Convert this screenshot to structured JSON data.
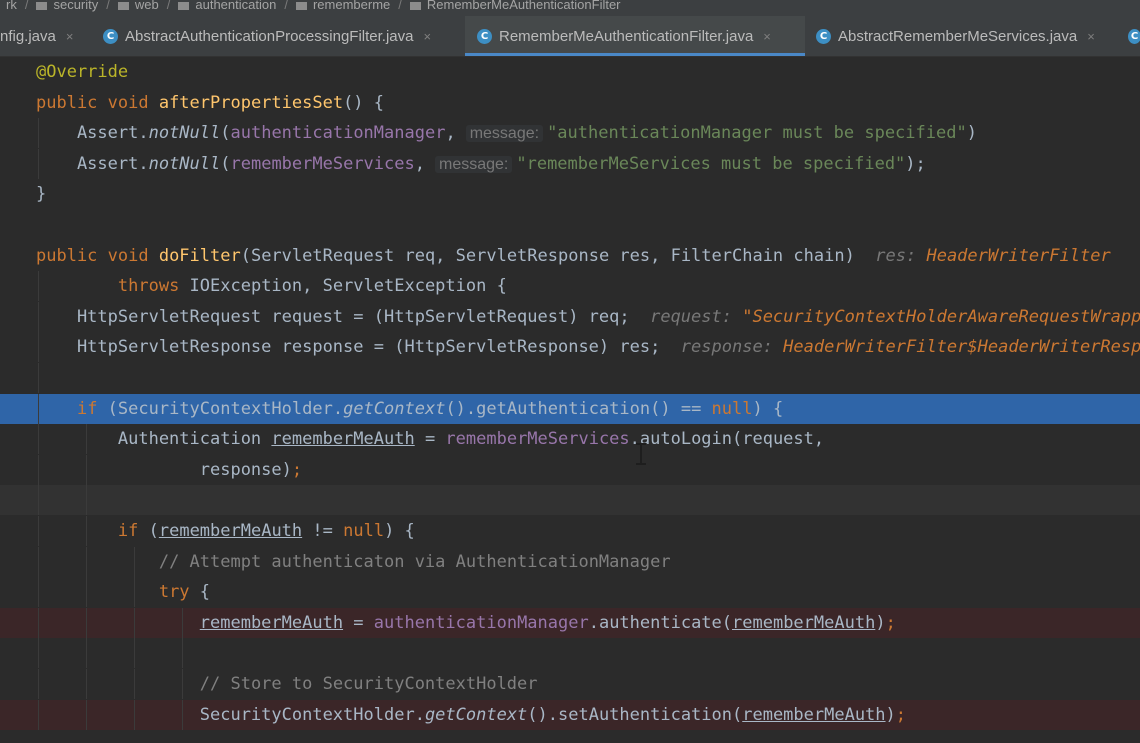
{
  "breadcrumb": [
    "rk",
    "security",
    "web",
    "authentication",
    "rememberme",
    "RememberMeAuthenticationFilter"
  ],
  "tabs": [
    {
      "label": "nfig.java",
      "close": "×"
    },
    {
      "label": "AbstractAuthenticationProcessingFilter.java",
      "close": "×"
    },
    {
      "label": "RememberMeAuthenticationFilter.java",
      "close": "×"
    },
    {
      "label": "AbstractRememberMeServices.java",
      "close": "×"
    }
  ],
  "icons": {
    "tab_class": "C",
    "tab_class_color": "#3d8fc4"
  },
  "colors": {
    "background": "#2b2b2b",
    "current_line": "#2f65a8",
    "breakpoint_line": "#3b2628",
    "keyword": "#cc7832",
    "string": "#6a8759",
    "field": "#9876aa",
    "function": "#ffc66d",
    "comment": "#808080"
  },
  "code": [
    [
      {
        "t": "@Override",
        "c": "ann"
      }
    ],
    [
      {
        "t": "public void ",
        "c": "kw"
      },
      {
        "t": "afterPropertiesSet",
        "c": "fn"
      },
      {
        "t": "() {"
      }
    ],
    [
      {
        "t": "    Assert."
      },
      {
        "t": "notNull",
        "c": "it"
      },
      {
        "t": "("
      },
      {
        "t": "authenticationManager",
        "c": "fld"
      },
      {
        "t": ","
      },
      {
        "t": "message:",
        "c": "hint"
      },
      {
        "t": "\"authenticationManager must be specified\"",
        "c": "str"
      },
      {
        "t": ")"
      }
    ],
    [
      {
        "t": "    Assert."
      },
      {
        "t": "notNull",
        "c": "it"
      },
      {
        "t": "("
      },
      {
        "t": "rememberMeServices",
        "c": "fld"
      },
      {
        "t": ","
      },
      {
        "t": "message:",
        "c": "hint"
      },
      {
        "t": "\"rememberMeServices must be specified\"",
        "c": "str"
      },
      {
        "t": ");"
      }
    ],
    [
      {
        "t": "}"
      }
    ],
    [],
    [
      {
        "t": "public void ",
        "c": "kw"
      },
      {
        "t": "doFilter",
        "c": "fn"
      },
      {
        "t": "(ServletRequest req, ServletResponse res, FilterChain chain)  "
      },
      {
        "t": "res: ",
        "c": "dbg"
      },
      {
        "t": "HeaderWriterFilter",
        "c": "dbgv"
      }
    ],
    [
      {
        "t": "        "
      },
      {
        "t": "throws ",
        "c": "kw"
      },
      {
        "t": "IOException, ServletException {"
      }
    ],
    [
      {
        "t": "    HttpServletRequest request = (HttpServletRequest) req;  "
      },
      {
        "t": "request: ",
        "c": "dbg"
      },
      {
        "t": "\"SecurityContextHolderAwareRequestWrapper\"",
        "c": "dbgv"
      }
    ],
    [
      {
        "t": "    HttpServletResponse response = (HttpServletResponse) res;  "
      },
      {
        "t": "response: ",
        "c": "dbg"
      },
      {
        "t": "HeaderWriterFilter$HeaderWriterResponse",
        "c": "dbgv"
      }
    ],
    [],
    [
      {
        "t": "    "
      },
      {
        "t": "if ",
        "c": "kw"
      },
      {
        "t": "(SecurityContextHolder."
      },
      {
        "t": "getContext",
        "c": "it"
      },
      {
        "t": "().getAuthentication() == "
      },
      {
        "t": "null",
        "c": "kw"
      },
      {
        "t": ") {"
      }
    ],
    [
      {
        "t": "        Authentication "
      },
      {
        "t": "rememberMeAuth",
        "c": "ul"
      },
      {
        "t": " = "
      },
      {
        "t": "rememberMeServices",
        "c": "fld"
      },
      {
        "t": ".autoLogin(request,"
      }
    ],
    [
      {
        "t": "                response)"
      },
      {
        "t": ";",
        "c": "kw"
      }
    ],
    [],
    [
      {
        "t": "        "
      },
      {
        "t": "if ",
        "c": "kw"
      },
      {
        "t": "("
      },
      {
        "t": "rememberMeAuth",
        "c": "ul"
      },
      {
        "t": " != "
      },
      {
        "t": "null",
        "c": "kw"
      },
      {
        "t": ") {"
      }
    ],
    [
      {
        "t": "            "
      },
      {
        "t": "// Attempt authenticaton via AuthenticationManager",
        "c": "cmt"
      }
    ],
    [
      {
        "t": "            "
      },
      {
        "t": "try ",
        "c": "kw"
      },
      {
        "t": "{"
      }
    ],
    [
      {
        "t": "                "
      },
      {
        "t": "rememberMeAuth",
        "c": "ul"
      },
      {
        "t": " = "
      },
      {
        "t": "authenticationManager",
        "c": "fld"
      },
      {
        "t": ".authenticate("
      },
      {
        "t": "rememberMeAuth",
        "c": "ul"
      },
      {
        "t": ")"
      },
      {
        "t": ";",
        "c": "kw"
      }
    ],
    [],
    [
      {
        "t": "                "
      },
      {
        "t": "// Store to SecurityContextHolder",
        "c": "cmt"
      }
    ],
    [
      {
        "t": "                SecurityContextHolder."
      },
      {
        "t": "getContext",
        "c": "it"
      },
      {
        "t": "().setAuthentication("
      },
      {
        "t": "rememberMeAuth",
        "c": "ul"
      },
      {
        "t": ")"
      },
      {
        "t": ";",
        "c": "kw"
      }
    ]
  ]
}
